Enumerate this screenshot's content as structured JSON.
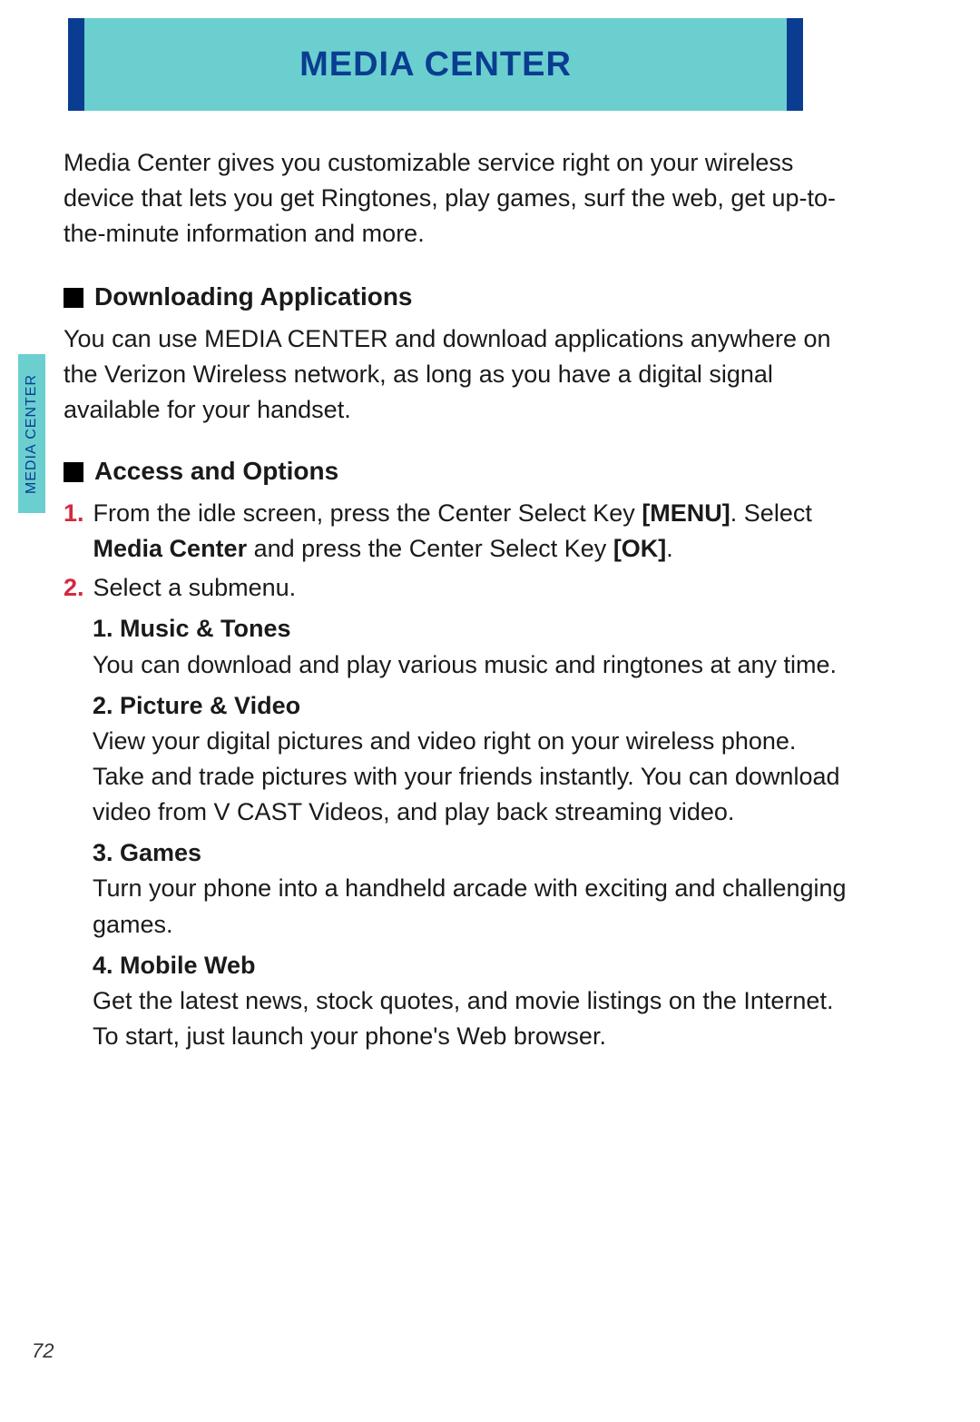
{
  "header": {
    "title": "MEDIA CENTER"
  },
  "side_tab": "MEDIA CENTER",
  "intro": "Media Center gives you customizable service right on your wireless device that lets you get Ringtones, play games, surf the web, get up-to-the-minute information and more.",
  "sections": {
    "downloading": {
      "title": "Downloading Applications",
      "body": "You can use MEDIA CENTER and download applications anywhere on the Verizon Wireless network, as long as you have a digital signal available for your handset."
    },
    "access": {
      "title": "Access and Options",
      "steps": {
        "s1": {
          "num": "1.",
          "pre": "From the idle screen, press the Center Select Key ",
          "menu": "[MENU]",
          "post1": ". Select ",
          "mc": "Media Center",
          "post2": " and press the Center Select Key ",
          "ok": "[OK]",
          "post3": "."
        },
        "s2": {
          "num": "2.",
          "text": "Select a submenu."
        }
      },
      "submenus": {
        "m1": {
          "title": "1. Music & Tones",
          "body": "You can download and play various music and ringtones at any time."
        },
        "m2": {
          "title": "2. Picture & Video",
          "body": "View your digital pictures and video right on your wireless phone. Take and trade pictures with your friends instantly. You can download video from V CAST Videos, and play back streaming video."
        },
        "m3": {
          "title": "3. Games",
          "body": "Turn your phone into a handheld arcade with exciting and challenging games."
        },
        "m4": {
          "title": "4. Mobile Web",
          "body": "Get the latest news, stock quotes, and movie listings on the Internet. To start, just launch your phone's Web browser."
        }
      }
    }
  },
  "page_number": "72"
}
